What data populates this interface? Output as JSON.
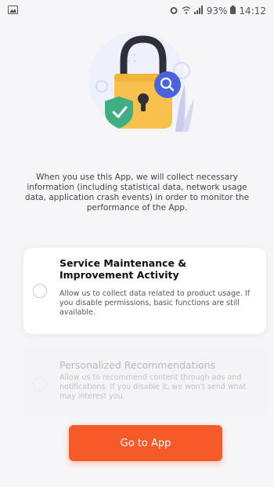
{
  "status_bar": {
    "battery_percent": "93%",
    "time": "14:12",
    "icons": [
      "gallery-icon",
      "alarm-icon",
      "wifi-icon",
      "signal-icon",
      "battery-icon"
    ]
  },
  "intro_text": "When you use this App, we will collect necessary information (including statistical data, network usage data, application crash events) in order to monitor the performance of the App.",
  "options": [
    {
      "title": "Service Maintenance & Improvement Activity",
      "description": "Allow us to collect data related to product usage. If you disable permissions, basic functions are still available.",
      "selected": false,
      "enabled": true
    },
    {
      "title": "Personalized Recommendations",
      "description": "Allow us to recommend content through ads and notifications. If you disable it, we won't send what may interest you.",
      "selected": false,
      "enabled": false
    }
  ],
  "cta": {
    "label": "Go to App",
    "color": "#f75a29"
  },
  "colors": {
    "background": "#f6f6f8",
    "accent": "#f75a29",
    "lock_body": "#f7c14b",
    "shield": "#3fae82",
    "magnifier": "#4a63e0"
  }
}
